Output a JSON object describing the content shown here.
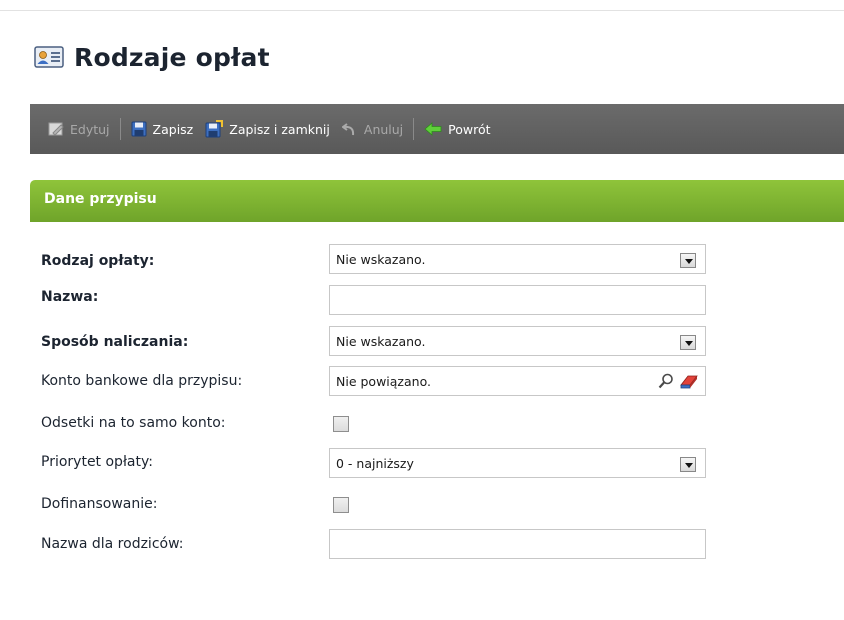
{
  "page": {
    "title": "Rodzaje opłat"
  },
  "toolbar": {
    "edit_label": "Edytuj",
    "save_label": "Zapisz",
    "save_close_label": "Zapisz i zamknij",
    "cancel_label": "Anuluj",
    "back_label": "Powrót"
  },
  "section": {
    "title": "Dane przypisu"
  },
  "form": {
    "fee_type": {
      "label": "Rodzaj opłaty:",
      "value": "Nie wskazano."
    },
    "name": {
      "label": "Nazwa:",
      "value": ""
    },
    "calc_method": {
      "label": "Sposób naliczania:",
      "value": "Nie wskazano."
    },
    "bank_account": {
      "label": "Konto bankowe dla przypisu:",
      "value": "Nie powiązano."
    },
    "interest_same_account": {
      "label": "Odsetki na to samo konto:",
      "checked": false
    },
    "priority": {
      "label": "Priorytet opłaty:",
      "value": "0 - najniższy"
    },
    "cofinancing": {
      "label": "Dofinansowanie:",
      "checked": false
    },
    "parents_name": {
      "label": "Nazwa dla rodziców:",
      "value": ""
    }
  },
  "colors": {
    "toolbar_bg": "#636363",
    "section_green": "#7db432",
    "title_color": "#1c2430"
  },
  "icons": [
    "id-card-icon",
    "edit-icon",
    "save-icon",
    "save-close-icon",
    "undo-icon",
    "back-arrow-icon",
    "search-icon",
    "eraser-icon",
    "dropdown-arrow-icon"
  ]
}
